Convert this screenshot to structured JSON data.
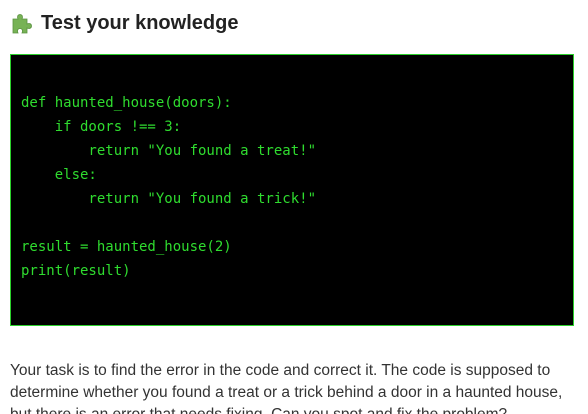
{
  "header": {
    "icon": "puzzle-piece-icon",
    "title": "Test your knowledge"
  },
  "colors": {
    "code_background": "#000000",
    "code_text": "#2fdc2f",
    "code_border": "#2bd02b",
    "icon_green": "#77b255"
  },
  "code": {
    "lines": [
      "def haunted_house(doors):",
      "    if doors !== 3:",
      "        return \"You found a treat!\"",
      "    else:",
      "        return \"You found a trick!\"",
      "",
      "result = haunted_house(2)",
      "print(result)"
    ]
  },
  "description": "Your task is to find the error in the code and correct it. The code is supposed to determine whether you found a treat or a trick behind a door in a haunted house, but there is an error that needs fixing. Can you spot and fix the problem?"
}
